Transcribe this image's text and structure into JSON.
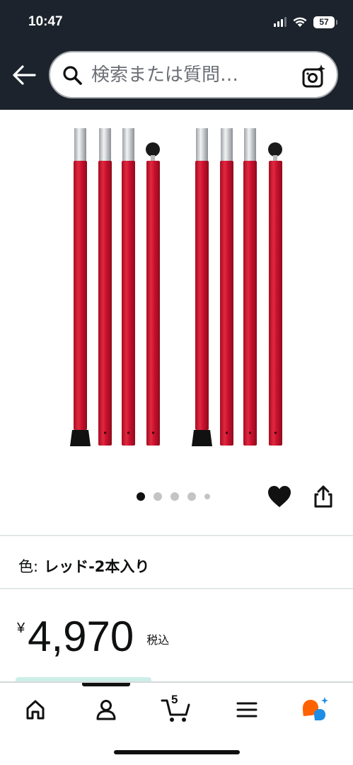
{
  "status_bar": {
    "time": "10:47",
    "battery": "57",
    "icons": [
      "signal-icon",
      "wifi-icon",
      "battery-icon"
    ]
  },
  "header": {
    "back_icon": "arrow-left-icon",
    "search_icon": "search-icon",
    "search_placeholder": "検索または質問…",
    "camera_icon": "camera-search-icon"
  },
  "product_image": {
    "carousel": {
      "total": 5,
      "active_index": 0
    },
    "actions": [
      "heart-icon",
      "share-icon"
    ]
  },
  "variant": {
    "label": "色:",
    "value": "レッド-2本入り"
  },
  "price": {
    "symbol": "¥",
    "value": "4,970",
    "tax_note": "税込"
  },
  "bottom_nav": {
    "items": [
      "home-icon",
      "account-icon",
      "cart-icon",
      "menu-icon",
      "ai-assistant-icon"
    ],
    "cart_count": "5",
    "active_index": 1
  },
  "colors": {
    "header_bg": "#1c232c",
    "pole_red": "#c8102e",
    "accent_orange": "#ff6200",
    "accent_blue": "#1d8de6"
  }
}
